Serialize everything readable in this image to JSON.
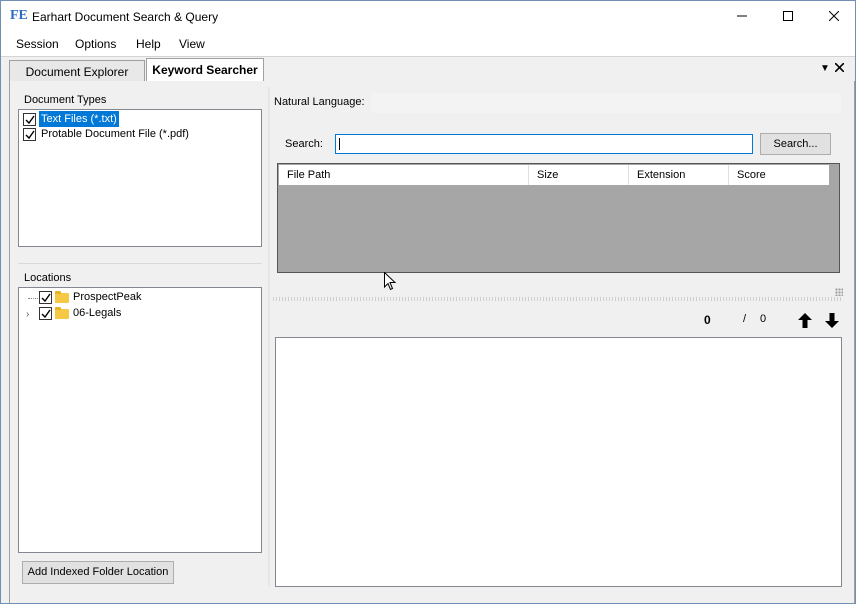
{
  "window": {
    "app_icon_text": "FE",
    "title": "Earhart Document Search & Query"
  },
  "menu": {
    "items": [
      "Session",
      "Options",
      "Help",
      "View"
    ]
  },
  "tabs": [
    {
      "label": "Document Explorer",
      "active": false
    },
    {
      "label": "Keyword Searcher",
      "active": true
    }
  ],
  "document_types": {
    "label": "Document Types",
    "items": [
      {
        "label": "Text Files (*.txt)",
        "checked": true,
        "selected": true
      },
      {
        "label": "Protable Document File (*.pdf)",
        "checked": true,
        "selected": false
      }
    ]
  },
  "locations": {
    "label": "Locations",
    "items": [
      {
        "label": "ProspectPeak",
        "checked": true,
        "expandable": false
      },
      {
        "label": "06-Legals",
        "checked": true,
        "expandable": true
      }
    ],
    "add_button": "Add Indexed Folder Location"
  },
  "natural_language": {
    "label": "Natural Language:"
  },
  "search": {
    "label": "Search:",
    "value": "",
    "button": "Search..."
  },
  "results_grid": {
    "columns": [
      "File Path",
      "Size",
      "Extension",
      "Score"
    ],
    "rows": []
  },
  "navigator": {
    "current": "0",
    "separator": "/",
    "total": "0"
  },
  "colors": {
    "selection": "#0078d7",
    "grid_background": "#a6a6a6",
    "folder": "#f7c843",
    "app_icon": "#2b6cc4"
  }
}
